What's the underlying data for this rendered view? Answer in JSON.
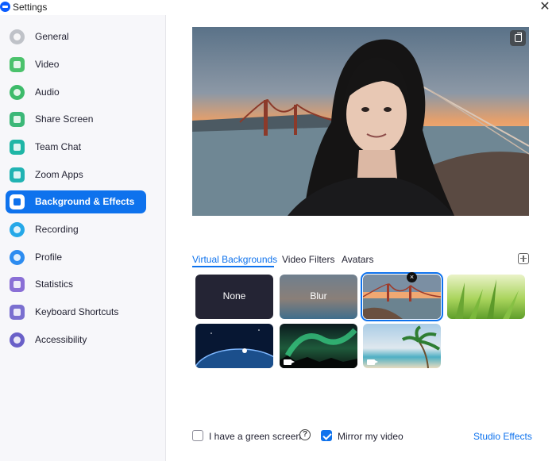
{
  "window": {
    "title": "Settings",
    "close_glyph": "✕"
  },
  "sidebar": {
    "items": [
      {
        "id": "general",
        "label": "General",
        "icon": "gear-icon",
        "color": "#bfc2c8",
        "active": false
      },
      {
        "id": "video",
        "label": "Video",
        "icon": "video-camera-icon",
        "color": "#4bc26c",
        "active": false
      },
      {
        "id": "audio",
        "label": "Audio",
        "icon": "headphones-icon",
        "color": "#3dbb6a",
        "active": false
      },
      {
        "id": "share-screen",
        "label": "Share Screen",
        "icon": "share-screen-icon",
        "color": "#3cb878",
        "active": false
      },
      {
        "id": "team-chat",
        "label": "Team Chat",
        "icon": "chat-bubble-icon",
        "color": "#1fb6a6",
        "active": false
      },
      {
        "id": "zoom-apps",
        "label": "Zoom Apps",
        "icon": "apps-icon",
        "color": "#21b3b3",
        "active": false
      },
      {
        "id": "background-effects",
        "label": "Background & Effects",
        "icon": "portrait-icon",
        "color": "#0e72ed",
        "active": true
      },
      {
        "id": "recording",
        "label": "Recording",
        "icon": "record-icon",
        "color": "#25a8e8",
        "active": false
      },
      {
        "id": "profile",
        "label": "Profile",
        "icon": "person-icon",
        "color": "#2d8cf0",
        "active": false
      },
      {
        "id": "statistics",
        "label": "Statistics",
        "icon": "bar-chart-icon",
        "color": "#8a6fd6",
        "active": false
      },
      {
        "id": "keyboard-shortcuts",
        "label": "Keyboard Shortcuts",
        "icon": "keyboard-icon",
        "color": "#7a6fd0",
        "active": false
      },
      {
        "id": "accessibility",
        "label": "Accessibility",
        "icon": "accessibility-icon",
        "color": "#6a60c8",
        "active": false
      }
    ]
  },
  "preview": {
    "pip_icon": "pip-icon"
  },
  "tabs": [
    {
      "label": "Virtual Backgrounds",
      "active": true
    },
    {
      "label": "Video Filters",
      "active": false
    },
    {
      "label": "Avatars",
      "active": false
    }
  ],
  "add_background_icon": "plus-icon",
  "backgrounds": [
    {
      "id": "none",
      "label": "None",
      "selected": false
    },
    {
      "id": "blur",
      "label": "Blur",
      "selected": false
    },
    {
      "id": "golden-gate",
      "label": "",
      "selected": true
    },
    {
      "id": "grass",
      "label": "",
      "selected": false
    },
    {
      "id": "earth",
      "label": "",
      "selected": false
    },
    {
      "id": "aurora",
      "label": "",
      "selected": false
    },
    {
      "id": "beach",
      "label": "",
      "selected": false
    }
  ],
  "remove_glyph": "×",
  "footer": {
    "green_screen_label": "I have a green screen",
    "green_screen_checked": false,
    "help_glyph": "?",
    "mirror_label": "Mirror my video",
    "mirror_checked": true,
    "studio_effects_label": "Studio Effects"
  },
  "colors": {
    "accent": "#0e72ed"
  }
}
